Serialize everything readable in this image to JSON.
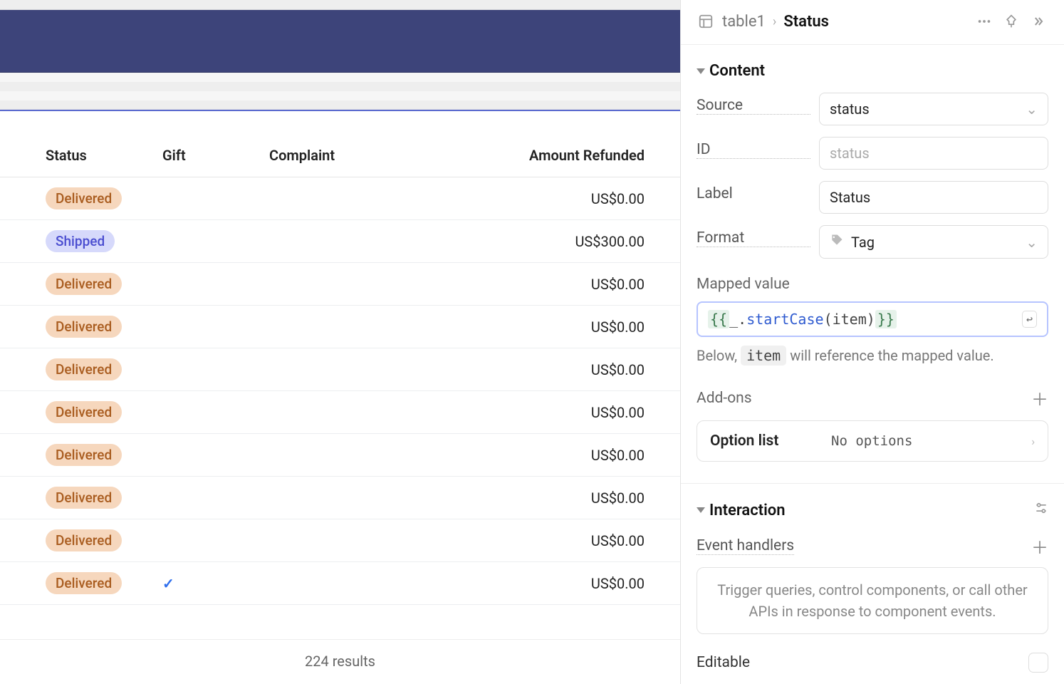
{
  "header": {
    "table_name": "table1",
    "column_name": "Status"
  },
  "sections": {
    "content": "Content",
    "interaction": "Interaction"
  },
  "content": {
    "source_label": "Source",
    "source_value": "status",
    "id_label": "ID",
    "id_placeholder": "status",
    "label_label": "Label",
    "label_value": "Status",
    "format_label": "Format",
    "format_value": "Tag",
    "mapped_label": "Mapped value",
    "mapped_code_open": "{{ ",
    "mapped_code_prefix": "_.",
    "mapped_code_fn": "startCase",
    "mapped_code_args": "(item)",
    "mapped_code_close": " }}",
    "hint_prefix": "Below, ",
    "hint_code": "item",
    "hint_suffix": " will reference the mapped value.",
    "addons_label": "Add-ons",
    "option_list_label": "Option list",
    "option_list_value": "No options"
  },
  "interaction": {
    "event_handlers_label": "Event handlers",
    "event_handlers_hint": "Trigger queries, control components, or call other APIs in response to component events.",
    "editable_label": "Editable"
  },
  "table": {
    "columns": {
      "status": "Status",
      "gift": "Gift",
      "complaint": "Complaint",
      "amount": "Amount Refunded"
    },
    "rows": [
      {
        "status": "Delivered",
        "status_variant": "delivered",
        "gift": false,
        "complaint": "",
        "amount": "US$0.00"
      },
      {
        "status": "Shipped",
        "status_variant": "shipped",
        "gift": false,
        "complaint": "",
        "amount": "US$300.00"
      },
      {
        "status": "Delivered",
        "status_variant": "delivered",
        "gift": false,
        "complaint": "",
        "amount": "US$0.00"
      },
      {
        "status": "Delivered",
        "status_variant": "delivered",
        "gift": false,
        "complaint": "",
        "amount": "US$0.00"
      },
      {
        "status": "Delivered",
        "status_variant": "delivered",
        "gift": false,
        "complaint": "",
        "amount": "US$0.00"
      },
      {
        "status": "Delivered",
        "status_variant": "delivered",
        "gift": false,
        "complaint": "",
        "amount": "US$0.00"
      },
      {
        "status": "Delivered",
        "status_variant": "delivered",
        "gift": false,
        "complaint": "",
        "amount": "US$0.00"
      },
      {
        "status": "Delivered",
        "status_variant": "delivered",
        "gift": false,
        "complaint": "",
        "amount": "US$0.00"
      },
      {
        "status": "Delivered",
        "status_variant": "delivered",
        "gift": false,
        "complaint": "",
        "amount": "US$0.00"
      },
      {
        "status": "Delivered",
        "status_variant": "delivered",
        "gift": true,
        "complaint": "",
        "amount": "US$0.00"
      }
    ],
    "footer": "224 results"
  }
}
